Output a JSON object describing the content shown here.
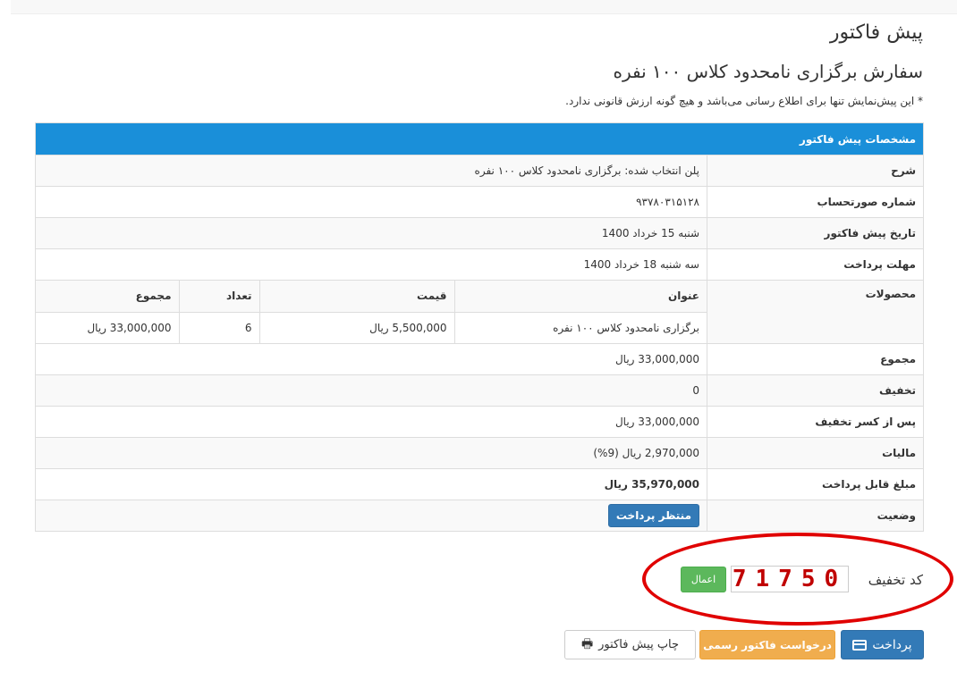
{
  "page": {
    "title": "پیش فاکتور",
    "subtitle": "سفارش برگزاری نامحدود کلاس ۱۰۰ نفره",
    "disclaimer": "* این پیش‌نمایش تنها برای اطلاع رسانی می‌باشد و هیچ گونه ارزش قانونی ندارد."
  },
  "invoice": {
    "header": "مشخصات پیش فاکتور",
    "rows": {
      "description": {
        "label": "شرح",
        "value": "پلن انتخاب شده: برگزاری نامحدود کلاس ۱۰۰ نفره"
      },
      "account_number": {
        "label": "شماره صورتحساب",
        "value": "۹۳۷۸۰۳۱۵۱۲۸"
      },
      "date": {
        "label": "تاریخ پیش فاکتور",
        "value": "شنبه 15 خرداد 1400"
      },
      "deadline": {
        "label": "مهلت پرداخت",
        "value": "سه شنبه 18 خرداد 1400"
      },
      "subtotal": {
        "label": "مجموع",
        "value": "33,000,000 ریال"
      },
      "discount": {
        "label": "تخفیف",
        "value": "0"
      },
      "after_discount": {
        "label": "پس از کسر تخفیف",
        "value": "33,000,000 ریال"
      },
      "tax": {
        "label": "مالیات",
        "value": "2,970,000 ریال (9%)"
      },
      "payable": {
        "label": "مبلغ قابل پرداخت",
        "value": "35,970,000 ریال"
      },
      "status": {
        "label": "وضعیت",
        "value": "منتظر پرداخت"
      }
    },
    "products": {
      "label": "محصولات",
      "columns": [
        "عنوان",
        "قیمت",
        "تعداد",
        "مجموع"
      ],
      "items": [
        [
          "برگزاری نامحدود کلاس ۱۰۰ نفره",
          "5,500,000 ریال",
          "6",
          "33,000,000 ریال"
        ]
      ]
    }
  },
  "coupon": {
    "label": "کد تخفیف",
    "value": "71750",
    "apply_label": "اعمال"
  },
  "actions": {
    "pay": "پرداخت",
    "official_invoice": "درخواست فاکتور رسمی",
    "print": "چاپ پیش فاکتور"
  },
  "colors": {
    "header_blue": "#1a8fd9",
    "primary": "#337ab7",
    "success": "#5cb85c",
    "warning": "#f0ad4e",
    "highlight": "#e00000"
  }
}
